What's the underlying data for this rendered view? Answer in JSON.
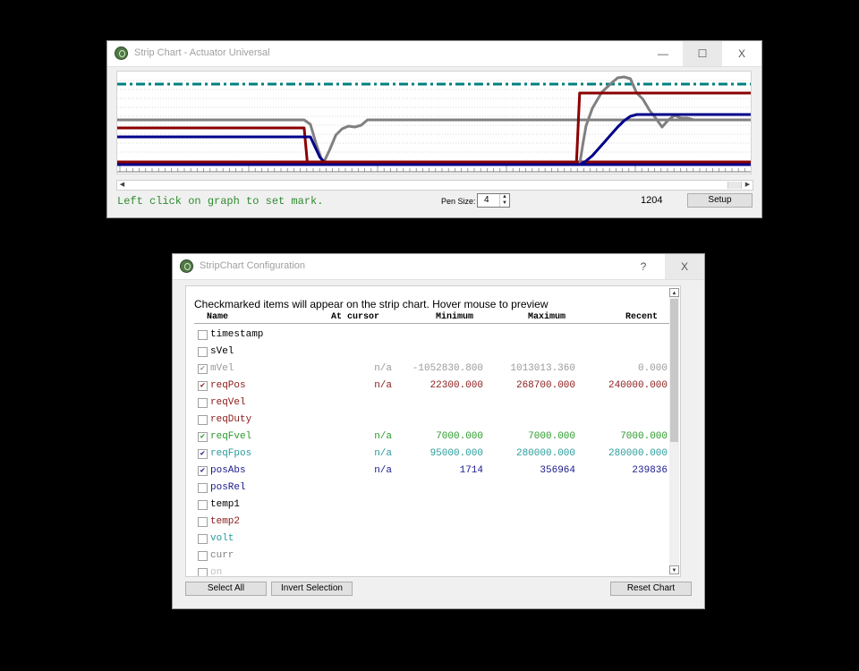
{
  "strip": {
    "title": "Strip Chart - Actuator Universal",
    "btn_min": "—",
    "btn_max": "☐",
    "btn_close": "X",
    "hint": "Left click on graph to set mark.",
    "pen_label": "Pen Size:",
    "pen_value": "4",
    "counter": "1204",
    "setup": "Setup",
    "scroll_left": "◀",
    "scroll_right": "▶"
  },
  "chart_data": {
    "type": "line",
    "xlabel": "",
    "ylabel": "",
    "xlim": [
      0,
      100
    ],
    "ylim": [
      0,
      100
    ],
    "series": [
      {
        "color": "#808080",
        "x": [
          0,
          29.5,
          30.5,
          31.5,
          32.5,
          33.5,
          34.5,
          35.5,
          36.5,
          37.5,
          38.5,
          39.5,
          100
        ],
        "y": [
          52,
          52,
          47,
          23,
          3,
          18,
          35,
          42,
          45,
          44,
          46,
          52,
          52
        ]
      },
      {
        "color": "#008080",
        "dashed": true,
        "x": [
          0,
          100
        ],
        "y": [
          92,
          92
        ]
      },
      {
        "color": "#8b0000",
        "x": [
          0,
          29.5,
          30,
          100
        ],
        "y": [
          43,
          43,
          5,
          5
        ]
      },
      {
        "color": "#00008b",
        "x": [
          0,
          30.5,
          32,
          33,
          34,
          100
        ],
        "y": [
          33,
          33,
          10,
          3,
          2,
          2
        ]
      },
      {
        "color": "#808080",
        "x": [
          0,
          73,
          73.5,
          74,
          75,
          76.5,
          78,
          79,
          80,
          81,
          82,
          83,
          84,
          85,
          86,
          87,
          88,
          89,
          90,
          91,
          92,
          93,
          94,
          95,
          96,
          97,
          98,
          99,
          100
        ],
        "y": [
          2,
          2,
          25,
          45,
          65,
          83,
          93,
          99,
          100,
          98,
          82,
          75,
          63,
          54,
          44,
          52,
          57,
          54,
          54,
          52,
          52,
          52,
          52,
          52,
          52,
          52,
          52,
          52,
          52
        ]
      },
      {
        "color": "#8b0000",
        "x": [
          0,
          72.5,
          73,
          100
        ],
        "y": [
          5,
          5,
          82,
          82
        ]
      },
      {
        "color": "#00008b",
        "x": [
          0,
          73,
          74,
          75,
          76,
          77,
          78,
          79,
          80,
          81,
          82,
          83,
          84,
          85,
          86,
          87,
          88,
          89,
          90,
          91,
          92,
          93,
          94,
          95,
          96,
          97,
          98,
          99,
          100
        ],
        "y": [
          2,
          2,
          6,
          12,
          20,
          28,
          36,
          44,
          51,
          56,
          58,
          58,
          58,
          58,
          58,
          58,
          58,
          58,
          58,
          58,
          58,
          58,
          58,
          58,
          58,
          58,
          58,
          58,
          58
        ]
      }
    ]
  },
  "config": {
    "title": "StripChart Configuration",
    "btn_help": "?",
    "btn_close": "X",
    "instructions": "Checkmarked items will appear on the strip chart.   Hover mouse to preview",
    "columns": {
      "name": "Name",
      "at_cursor": "At cursor",
      "minimum": "Minimum",
      "maximum": "Maximum",
      "recent": "Recent"
    },
    "rows": [
      {
        "name": "timestamp",
        "checked": false,
        "color": "#000000",
        "at": "",
        "min": "",
        "max": "",
        "recent": ""
      },
      {
        "name": "sVel",
        "checked": false,
        "color": "#000000",
        "at": "",
        "min": "",
        "max": "",
        "recent": ""
      },
      {
        "name": "mVel",
        "checked": true,
        "color": "#9a9a9a",
        "at": "n/a",
        "min": "-1052830.800",
        "max": "1013013.360",
        "recent": "0.000"
      },
      {
        "name": "reqPos",
        "checked": true,
        "color": "#8b1a1a",
        "at": "n/a",
        "min": "22300.000",
        "max": "268700.000",
        "recent": "240000.000"
      },
      {
        "name": "reqVel",
        "checked": false,
        "color": "#8b1a1a",
        "at": "",
        "min": "",
        "max": "",
        "recent": ""
      },
      {
        "name": "reqDuty",
        "checked": false,
        "color": "#8b1a1a",
        "at": "",
        "min": "",
        "max": "",
        "recent": ""
      },
      {
        "name": "reqFvel",
        "checked": true,
        "color": "#2a9a2a",
        "at": "n/a",
        "min": "7000.000",
        "max": "7000.000",
        "recent": "7000.000"
      },
      {
        "name": "reqFpos",
        "checked": true,
        "color": "#2a9a9a",
        "at": "n/a",
        "min": "95000.000",
        "max": "280000.000",
        "recent": "280000.000"
      },
      {
        "name": "posAbs",
        "checked": true,
        "color": "#1a1a8b",
        "at": "n/a",
        "min": "1714",
        "max": "356964",
        "recent": "239836"
      },
      {
        "name": "posRel",
        "checked": false,
        "color": "#1a1a8b",
        "at": "",
        "min": "",
        "max": "",
        "recent": ""
      },
      {
        "name": "temp1",
        "checked": false,
        "color": "#000000",
        "at": "",
        "min": "",
        "max": "",
        "recent": ""
      },
      {
        "name": "temp2",
        "checked": false,
        "color": "#8b1a1a",
        "at": "",
        "min": "",
        "max": "",
        "recent": ""
      },
      {
        "name": "volt",
        "checked": false,
        "color": "#2a9a9a",
        "at": "",
        "min": "",
        "max": "",
        "recent": ""
      },
      {
        "name": "curr",
        "checked": false,
        "color": "#808080",
        "at": "",
        "min": "",
        "max": "",
        "recent": ""
      },
      {
        "name": "on",
        "checked": false,
        "color": "#c0c0c0",
        "at": "",
        "min": "",
        "max": "",
        "recent": ""
      }
    ],
    "select_all": "Select All",
    "invert_selection": "Invert Selection",
    "reset_chart": "Reset Chart",
    "scroll_up": "▲",
    "scroll_down": "▼"
  }
}
